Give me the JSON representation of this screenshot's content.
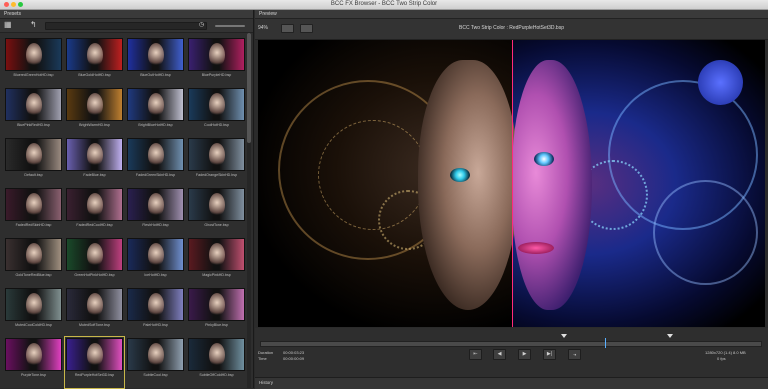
{
  "window": {
    "title": "BCC FX Browser - BCC Two Strip Color"
  },
  "presets_panel": {
    "title": "Presets",
    "items": [
      {
        "label": "BlueredGreenHotHD.bsp",
        "colors": [
          "#7a1010",
          "#1a3a5a"
        ]
      },
      {
        "label": "BlueGoldHotHD.bsp",
        "colors": [
          "#1a3a8a",
          "#c02020"
        ]
      },
      {
        "label": "BlueOutHotHD.bsp",
        "colors": [
          "#2030a0",
          "#4060d0"
        ]
      },
      {
        "label": "BluePurpleHD.bsp",
        "colors": [
          "#3a2070",
          "#b02060"
        ]
      },
      {
        "label": "BluePinkRedHD.bsp",
        "colors": [
          "#203060",
          "#a0a0b0"
        ]
      },
      {
        "label": "BrightWarmHD.bsp",
        "colors": [
          "#5a3a10",
          "#c08030"
        ]
      },
      {
        "label": "BrightBlueHotHD.bsp",
        "colors": [
          "#203a80",
          "#c0c0d0"
        ]
      },
      {
        "label": "CoolHotHD.bsp",
        "colors": [
          "#1a3a5a",
          "#7090b0"
        ]
      },
      {
        "label": "Default.bsp",
        "colors": [
          "#2a2a2a",
          "#9a8a80"
        ]
      },
      {
        "label": "FadeBlue.bsp",
        "colors": [
          "#6a60b0",
          "#c0b0f0"
        ]
      },
      {
        "label": "FadedGreenSkinHD.bsp",
        "colors": [
          "#1a3a5a",
          "#7090b0"
        ]
      },
      {
        "label": "FadedOrangeSkinHD.bsp",
        "colors": [
          "#2a3a4a",
          "#8090a0"
        ]
      },
      {
        "label": "FadedRedSkinHD.bsp",
        "colors": [
          "#3a1a2a",
          "#8a6070"
        ]
      },
      {
        "label": "FadedRedCoolHD.bsp",
        "colors": [
          "#3a2030",
          "#b07090"
        ]
      },
      {
        "label": "FleshHotHD.bsp",
        "colors": [
          "#2a2050",
          "#a090b0"
        ]
      },
      {
        "label": "GhostTone.bsp",
        "colors": [
          "#2a3a4a",
          "#8090a0"
        ]
      },
      {
        "label": "GoldToneRedBlue.bsp",
        "colors": [
          "#3a3030",
          "#a09080"
        ]
      },
      {
        "label": "GreenHotPinkHotHD.bsp",
        "colors": [
          "#1a4a2a",
          "#c04080"
        ]
      },
      {
        "label": "IceHotHD.bsp",
        "colors": [
          "#1a2a5a",
          "#7090d0"
        ]
      },
      {
        "label": "MagicPinkHD.bsp",
        "colors": [
          "#5a1a20",
          "#c05070"
        ]
      },
      {
        "label": "MutedCoolColdHD.bsp",
        "colors": [
          "#2a3a3a",
          "#809090"
        ]
      },
      {
        "label": "MutedSoftTone.bsp",
        "colors": [
          "#2a2a3a",
          "#9090a0"
        ]
      },
      {
        "label": "PaleHotHD.bsp",
        "colors": [
          "#1a2a4a",
          "#8080c0"
        ]
      },
      {
        "label": "PinkyBlue.bsp",
        "colors": [
          "#3a1a4a",
          "#c070b0"
        ]
      },
      {
        "label": "PurpleTone.bsp",
        "colors": [
          "#6a1060",
          "#e040c0"
        ]
      },
      {
        "label": "RedPurpleHotSet3D.bsp",
        "colors": [
          "#3a2090",
          "#e050c0"
        ],
        "selected": true
      },
      {
        "label": "SubtleCool.bsp",
        "colors": [
          "#2a3a4a",
          "#90a0b0"
        ]
      },
      {
        "label": "SubtleOffColdHD.bsp",
        "colors": [
          "#1a2a3a",
          "#7090a0"
        ]
      }
    ]
  },
  "preview_panel": {
    "title": "Preview",
    "zoom": "94%",
    "image_title": "BCC Two Strip Color : RedPurpleHotSet3D.bsp"
  },
  "playback": {
    "duration_label": "Duration",
    "duration_value": "00:00:03:23",
    "time_label": "Time",
    "time_value": "00:00:00:09",
    "dimensions": "1280x720 (1.4) 8.0 MB",
    "fps": "0 fps",
    "controls": [
      "⇤",
      "◀",
      "▶",
      "▶|",
      "⇥"
    ],
    "playhead_fraction": 0.69
  },
  "history": {
    "title": "History"
  },
  "colors": {
    "accent_split": "#ff2a7a",
    "selection": "#c8b74a"
  }
}
